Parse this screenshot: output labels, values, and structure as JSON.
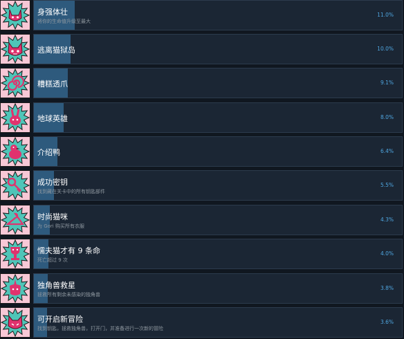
{
  "achievements": [
    {
      "title": "身强体壮",
      "description": "将你的生命值升级至最大",
      "percent": "11.0%",
      "fill": 0.11,
      "icon": "cat-face-icon"
    },
    {
      "title": "逃离猫狱岛",
      "description": "",
      "percent": "10.0%",
      "fill": 0.1,
      "icon": "devil-cat-icon"
    },
    {
      "title": "糟糕透爪",
      "description": "",
      "percent": "9.1%",
      "fill": 0.091,
      "icon": "spiral-icon"
    },
    {
      "title": "地球英雄",
      "description": "",
      "percent": "8.0%",
      "fill": 0.08,
      "icon": "rabbit-icon"
    },
    {
      "title": "介绍鸭",
      "description": "",
      "percent": "6.4%",
      "fill": 0.064,
      "icon": "duck-icon"
    },
    {
      "title": "成功密钥",
      "description": "找到藏在关卡中的所有钥匙部件",
      "percent": "5.5%",
      "fill": 0.055,
      "icon": "key-icon"
    },
    {
      "title": "时尚猫咪",
      "description": "为 Gori 购买所有衣服",
      "percent": "4.3%",
      "fill": 0.043,
      "icon": "hanger-icon"
    },
    {
      "title": "懦夫猫才有 9 条命",
      "description": "死亡超过 9 次",
      "percent": "4.0%",
      "fill": 0.04,
      "icon": "trophy-icon"
    },
    {
      "title": "独角兽救星",
      "description": "拯救所有剩余未感染的独角兽",
      "percent": "3.8%",
      "fill": 0.038,
      "icon": "unicorn-icon"
    },
    {
      "title": "可开启新冒险",
      "description": "找到钥匙，拯救独角兽，打开门，并准备进行一次新的冒险",
      "percent": "3.6%",
      "fill": 0.036,
      "icon": "door-cat-icon"
    }
  ],
  "colors": {
    "badge": "#f7c8d6",
    "burst": "#4fc5b8",
    "accent": "#e0326e"
  }
}
